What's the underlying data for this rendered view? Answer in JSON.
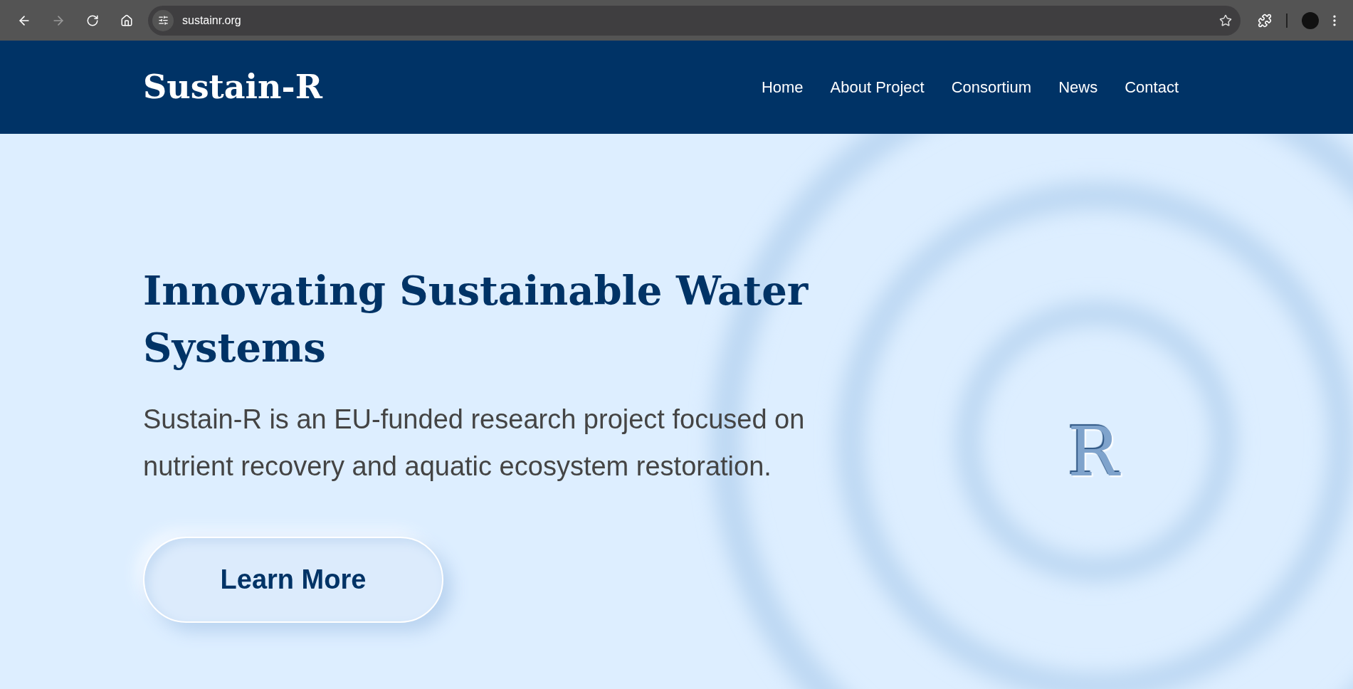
{
  "browser": {
    "url": "sustainr.org",
    "forward": {
      "disabled": true
    }
  },
  "header": {
    "logo": "Sustain-R",
    "nav": [
      "Home",
      "About Project",
      "Consortium",
      "News",
      "Contact"
    ]
  },
  "hero": {
    "title": "Innovating Sustainable Water Systems",
    "text": "Sustain-R is an EU-funded research project focused on nutrient recovery and aquatic ecosystem restoration.",
    "button": "Learn More",
    "emblem": "R"
  }
}
